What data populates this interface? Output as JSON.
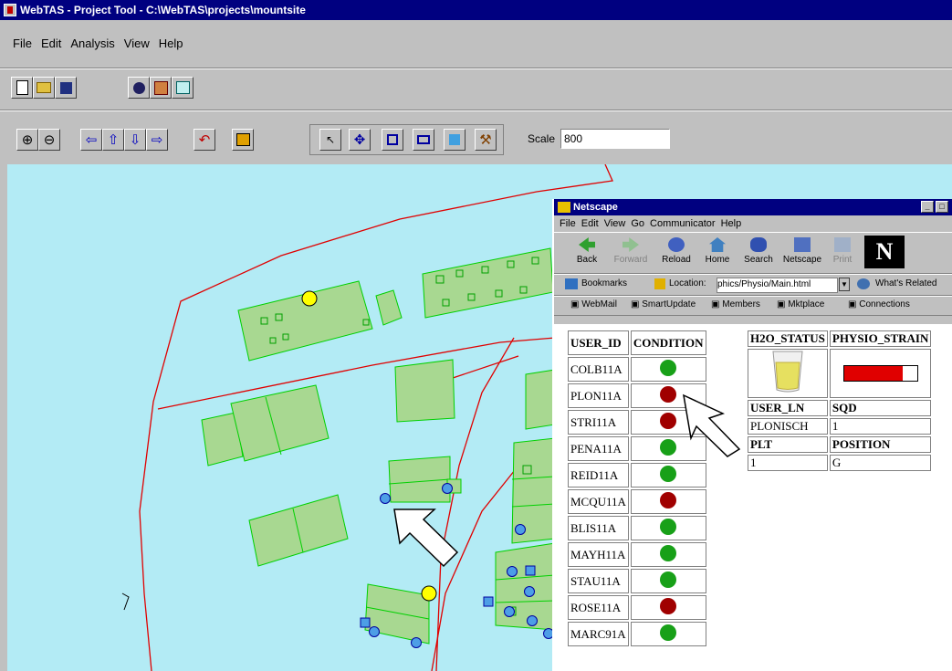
{
  "window": {
    "title": "WebTAS - Project Tool - C:\\WebTAS\\projects\\mountsite"
  },
  "menu": [
    "File",
    "Edit",
    "Analysis",
    "View",
    "Help"
  ],
  "toolbar": {
    "scale_label": "Scale",
    "scale_value": "800"
  },
  "netscape": {
    "title": "Netscape",
    "menu": [
      "File",
      "Edit",
      "View",
      "Go",
      "Communicator",
      "Help"
    ],
    "nav": [
      "Back",
      "Forward",
      "Reload",
      "Home",
      "Search",
      "Netscape",
      "Print"
    ],
    "bookmarks_label": "Bookmarks",
    "location_label": "Location:",
    "location_value": "phics/Physio/Main.html",
    "whats_related": "What's Related",
    "links": [
      "WebMail",
      "SmartUpdate",
      "Members",
      "Mktplace",
      "Connections"
    ]
  },
  "users_table": {
    "headers": [
      "USER_ID",
      "CONDITION"
    ],
    "rows": [
      {
        "id": "COLB11A",
        "condition": "green"
      },
      {
        "id": "PLON11A",
        "condition": "red"
      },
      {
        "id": "STRI11A",
        "condition": "red"
      },
      {
        "id": "PENA11A",
        "condition": "green"
      },
      {
        "id": "REID11A",
        "condition": "green"
      },
      {
        "id": "MCQU11A",
        "condition": "red"
      },
      {
        "id": "BLIS11A",
        "condition": "green"
      },
      {
        "id": "MAYH11A",
        "condition": "green"
      },
      {
        "id": "STAU11A",
        "condition": "green"
      },
      {
        "id": "ROSE11A",
        "condition": "red"
      },
      {
        "id": "MARC91A",
        "condition": "green"
      }
    ]
  },
  "detail": {
    "h2o_status_label": "H2O_STATUS",
    "physio_strain_label": "PHYSIO_STRAIN",
    "user_ln_label": "USER_LN",
    "sqd_label": "SQD",
    "user_ln": "PLONISCH",
    "sqd": "1",
    "plt_label": "PLT",
    "position_label": "POSITION",
    "plt": "1",
    "position": "G",
    "strain_level": 0.8
  },
  "colors": {
    "map_water": "#b3ebf5",
    "building": "#a8d891",
    "building_edge": "#00d000",
    "road": "#e00000",
    "ok": "#18a018",
    "alert": "#a00000",
    "title_bar": "#000080"
  }
}
